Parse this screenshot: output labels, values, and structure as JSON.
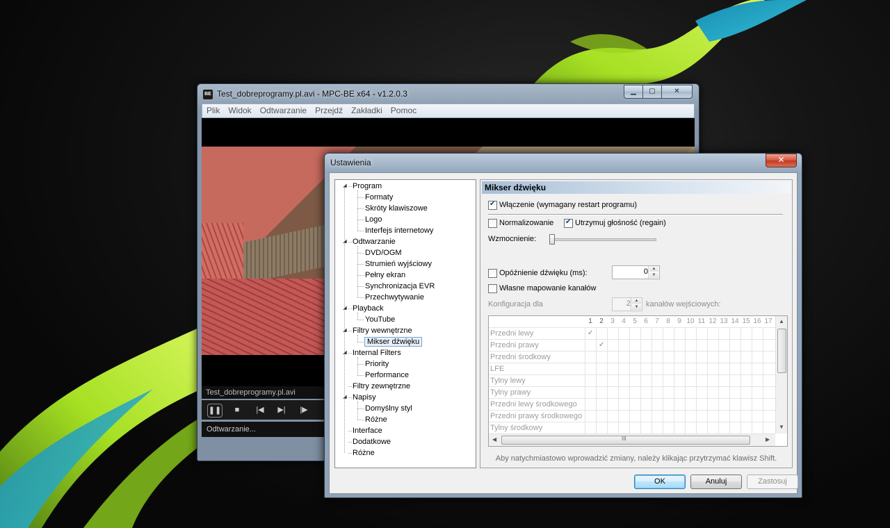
{
  "player": {
    "title": "Test_dobreprogramy.pl.avi - MPC-BE x64 - v1.2.0.3",
    "app_icon": "BE",
    "caption": {
      "minimize": "▁",
      "maximize": "▢",
      "close": "✕"
    },
    "menu": [
      "Plik",
      "Widok",
      "Odtwarzanie",
      "Przejdź",
      "Zakładki",
      "Pomoc"
    ],
    "filename": "Test_dobreprogramy.pl.avi",
    "status": "Odtwarzanie...",
    "controls": {
      "pause": "❚❚",
      "stop": "■",
      "prev": "|◀",
      "next": "▶|",
      "step": "|▶"
    }
  },
  "dialog": {
    "title": "Ustawienia",
    "close": "✕",
    "tree": [
      {
        "label": "Program",
        "level": 0,
        "expandable": true
      },
      {
        "label": "Formaty",
        "level": 1
      },
      {
        "label": "Skróty klawiszowe",
        "level": 1
      },
      {
        "label": "Logo",
        "level": 1
      },
      {
        "label": "Interfejs internetowy",
        "level": 1
      },
      {
        "label": "Odtwarzanie",
        "level": 0,
        "expandable": true
      },
      {
        "label": "DVD/OGM",
        "level": 1
      },
      {
        "label": "Strumień wyjściowy",
        "level": 1
      },
      {
        "label": "Pełny ekran",
        "level": 1
      },
      {
        "label": "Synchronizacja EVR",
        "level": 1
      },
      {
        "label": "Przechwytywanie",
        "level": 1
      },
      {
        "label": "Playback",
        "level": 0,
        "expandable": true
      },
      {
        "label": "YouTube",
        "level": 1
      },
      {
        "label": "Filtry wewnętrzne",
        "level": 0,
        "expandable": true
      },
      {
        "label": "Mikser dźwięku",
        "level": 1,
        "selected": true
      },
      {
        "label": "Internal Filters",
        "level": 0,
        "expandable": true
      },
      {
        "label": "Priority",
        "level": 1
      },
      {
        "label": "Performance",
        "level": 1
      },
      {
        "label": "Filtry zewnętrzne",
        "level": 0
      },
      {
        "label": "Napisy",
        "level": 0,
        "expandable": true
      },
      {
        "label": "Domyślny styl",
        "level": 1
      },
      {
        "label": "Różne",
        "level": 1
      },
      {
        "label": "Interface",
        "level": 0
      },
      {
        "label": "Dodatkowe",
        "level": 0
      },
      {
        "label": "Różne",
        "level": 0
      }
    ],
    "panel": {
      "header": "Mikser dźwięku",
      "enable_label": "Włączenie (wymagany restart programu)",
      "enable_checked": true,
      "normalize_label": "Normalizowanie",
      "normalize_checked": false,
      "regain_label": "Utrzymuj głośność (regain)",
      "regain_checked": true,
      "gain_label": "Wzmocnienie:",
      "gain_value": 0,
      "delay_label": "Opóźnienie dźwięku (ms):",
      "delay_checked": false,
      "delay_value": "0",
      "mapping_label": "Własne mapowanie kanałów",
      "mapping_checked": false,
      "config_label": "Konfiguracja dla",
      "config_value": "2",
      "config_suffix": "kanałów wejściowych:",
      "grid": {
        "columns": [
          "1",
          "2",
          "3",
          "4",
          "5",
          "6",
          "7",
          "8",
          "9",
          "10",
          "11",
          "12",
          "13",
          "14",
          "15",
          "16",
          "17"
        ],
        "rows": [
          {
            "label": "Przedni lewy",
            "checks": [
              1
            ]
          },
          {
            "label": "Przedni prawy",
            "checks": [
              2
            ]
          },
          {
            "label": "Przedni środkowy",
            "checks": []
          },
          {
            "label": "LFE",
            "checks": []
          },
          {
            "label": "Tylny lewy",
            "checks": []
          },
          {
            "label": "Tylny prawy",
            "checks": []
          },
          {
            "label": "Przedni lewy środkowego",
            "checks": []
          },
          {
            "label": "Przedni prawy środkowego",
            "checks": []
          },
          {
            "label": "Tylny środkowy",
            "checks": []
          }
        ],
        "scroll_grip": "III"
      },
      "hint": "Aby natychmiastowo wprowadzić zmiany, należy klikając przytrzymać klawisz Shift."
    },
    "buttons": {
      "ok": "OK",
      "cancel": "Anuluj",
      "apply": "Zastosuj"
    }
  }
}
